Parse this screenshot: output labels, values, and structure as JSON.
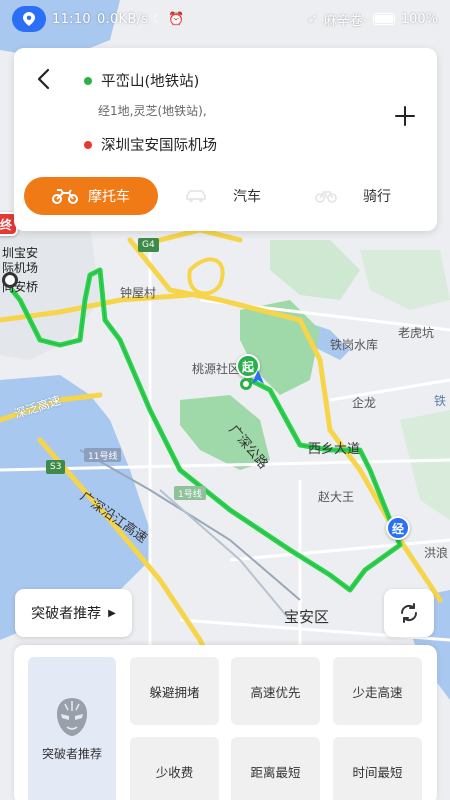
{
  "status_bar": {
    "time": "11:10",
    "speed": "0.0KB/s",
    "carrier": "麻辛卷·",
    "battery": "100%",
    "location_icon": "location-pin-icon"
  },
  "route": {
    "start": "平峦山(地铁站)",
    "via": "经1地,灵芝(地铁站),",
    "end": "深圳宝安国际机场",
    "start_color": "#2ab04a",
    "end_color": "#e53935"
  },
  "modes": [
    {
      "label": "摩托车",
      "icon": "motorcycle-icon",
      "active": true
    },
    {
      "label": "汽车",
      "icon": "car-icon",
      "active": false
    },
    {
      "label": "骑行",
      "icon": "bicycle-icon",
      "active": false
    }
  ],
  "map": {
    "labels": {
      "zhongwucun": "钟屋村",
      "taoyuanshe": "桃源社区",
      "tiegangshuiku": "铁岗水库",
      "laohukeng": "老虎坑",
      "qilong": "企龙",
      "tie": "铁",
      "xixiangdadao": "西乡大道",
      "guangshengonglu": "广深公路",
      "zhaodawang": "赵大王",
      "hongshen": "洪浪",
      "baoanqu": "宝安区",
      "guangshenyanjiang": "广深沿江高速",
      "guangshen_gaosu": "深泛高速",
      "airport_1": "圳宝安",
      "airport_2": "际机场",
      "airport_3": "同安桥",
      "line11": "11号线",
      "line1": "1号线",
      "g4": "G4",
      "s3": "S3"
    },
    "pins": {
      "end_badge": "终",
      "start_badge": "起",
      "via_badge": "经"
    },
    "colors": {
      "route": "#2ed24f",
      "highway": "#f6d54a",
      "water": "#a9c8ef",
      "green": "#9fd9a9"
    }
  },
  "recommend_button": "突破者推荐",
  "preferences": {
    "main_label": "突破者推荐",
    "options": [
      "躲避拥堵",
      "高速优先",
      "少走高速",
      "少收费",
      "距离最短",
      "时间最短"
    ]
  }
}
